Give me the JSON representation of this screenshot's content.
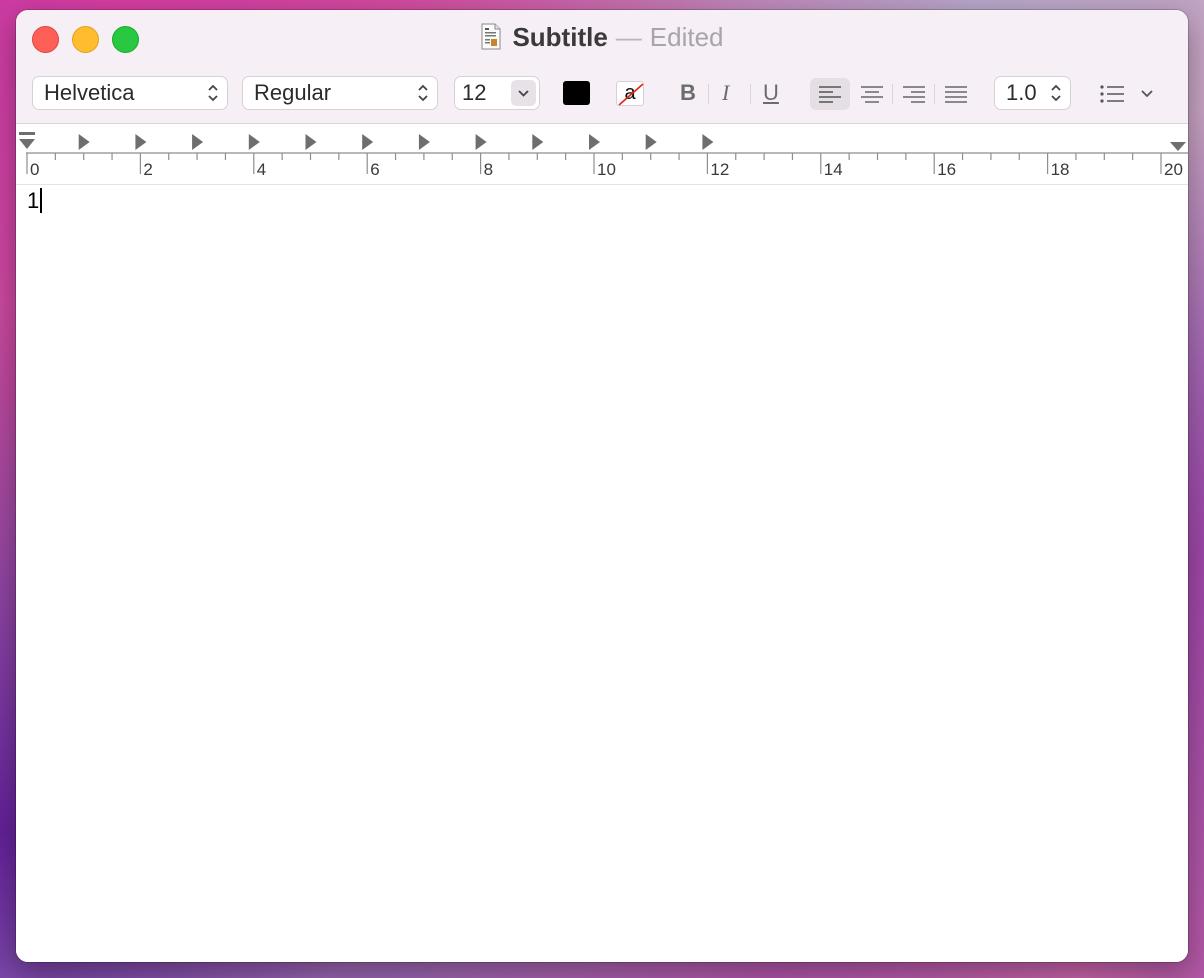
{
  "window": {
    "title": "Subtitle",
    "separator": "—",
    "status": "Edited"
  },
  "toolbar": {
    "font_family": "Helvetica",
    "font_style": "Regular",
    "font_size": "12",
    "text_color": "#000000",
    "background_glyph": "a",
    "bold_label": "B",
    "italic_label": "I",
    "underline_label": "U",
    "line_spacing": "1.0"
  },
  "ruler": {
    "labels": [
      "0",
      "2",
      "4",
      "6",
      "8",
      "10",
      "12",
      "14",
      "16",
      "18",
      "20"
    ]
  },
  "document": {
    "text": "1"
  },
  "colors": {
    "close": "#fe5f57",
    "minimize": "#febc2e",
    "maximize": "#28c840",
    "titlebar": "#f6eff6"
  }
}
